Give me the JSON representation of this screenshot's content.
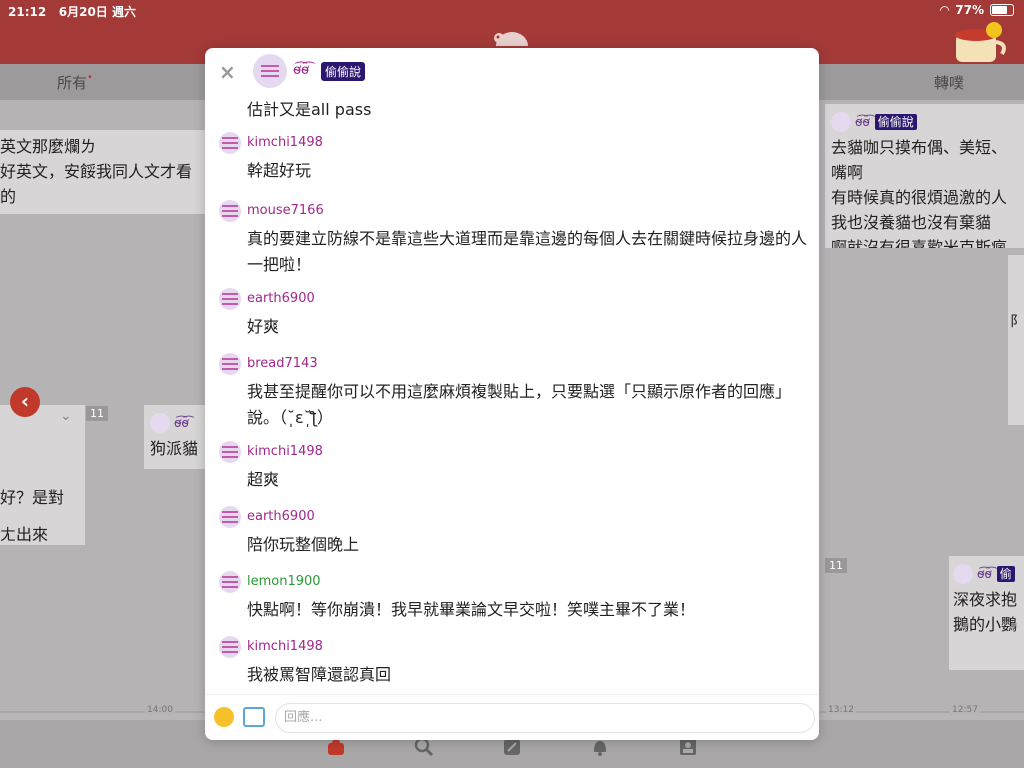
{
  "status": {
    "time": "21:12",
    "date": "6月20日 週六",
    "battery": "77%",
    "battery_level": 0.77
  },
  "tabs": [
    {
      "label": "所有",
      "dot": "•"
    },
    {
      "label": "轉噗"
    }
  ],
  "colors": {
    "brand": "#a33a38",
    "badge": "#2b1670",
    "username_purple": "#a0278b",
    "username_green": "#2a9a33"
  },
  "background_cards": {
    "left_top_lines": [
      "英文那麼爛ㄌ",
      "好英文，安餒我同人文才看的"
    ],
    "left_mid_lines": [
      "好？是對",
      "ㄤ出來"
    ],
    "mid_card": {
      "name": "ơ̴̴͡ơ̴̴͡",
      "text": "狗派貓"
    },
    "right_top": {
      "name": "ơ̴̴͡ơ̴̴͡",
      "badge": "偷偷說",
      "lines": [
        "去貓咖只摸布偶、美短、",
        "嘴啊",
        "有時候真的很煩過激的人",
        "我也沒養貓也沒有棄貓",
        "啊就沒有很喜歡米克斯瘋"
      ]
    },
    "right_bottom": {
      "name": "ơ̴̴͡ơ̴̴͡",
      "badge": "偷",
      "lines": [
        "深夜求抱",
        "鵝的小鸚"
      ]
    },
    "right_partial": "阝",
    "counts": [
      "11",
      "11",
      "11"
    ]
  },
  "timeline_labels": [
    "14:00",
    "13:12",
    "12:57"
  ],
  "modal": {
    "close_glyph": "×",
    "op": {
      "name": "ơ̴̴͡ơ̴̴͡",
      "badge": "偷偷說",
      "text": "估計又是all pass"
    },
    "responses": [
      {
        "user": "kimchi1498",
        "text": "幹超好玩",
        "color": "purple"
      },
      {
        "user": "mouse7166",
        "text": "真的要建立防線不是靠這些大道理而是靠這邊的每個人去在關鍵時候拉身邊的人一把啦！",
        "color": "purple"
      },
      {
        "user": "earth6900",
        "text": "好爽",
        "color": "purple"
      },
      {
        "user": "bread7143",
        "text": "我甚至提醒你可以不用這麼麻煩複製貼上，只要點選「只顯示原作者的回應」說。（˘̩̩̩ε˘̩ƪ）",
        "color": "purple"
      },
      {
        "user": "kimchi1498",
        "text": "超爽",
        "color": "purple"
      },
      {
        "user": "earth6900",
        "text": "陪你玩整個晚上",
        "color": "purple"
      },
      {
        "user": "lemon1900",
        "text": "快點啊！等你崩潰！我早就畢業論文早交啦！笑噗主畢不了業！",
        "color": "green"
      },
      {
        "user": "kimchi1498",
        "text": "我被罵智障還認真回",
        "color": "purple"
      }
    ],
    "reply_placeholder": "回應..."
  }
}
